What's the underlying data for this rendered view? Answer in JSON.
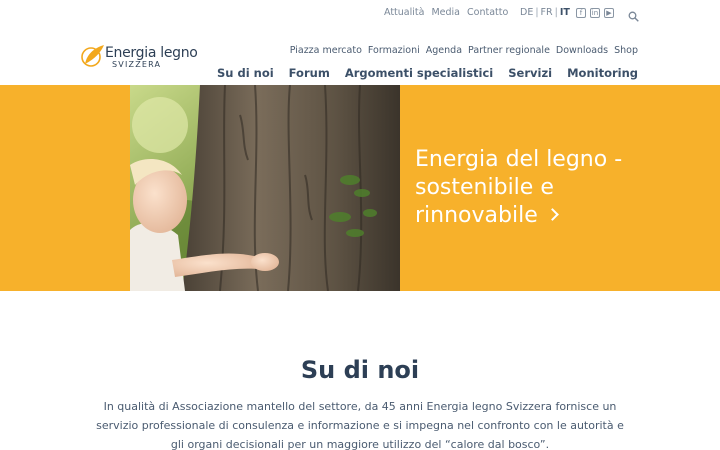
{
  "util": {
    "links": [
      "Attualità",
      "Media",
      "Contatto"
    ],
    "languages": [
      {
        "code": "DE",
        "active": false
      },
      {
        "code": "FR",
        "active": false
      },
      {
        "code": "IT",
        "active": true
      }
    ],
    "social_icons": [
      "facebook-icon",
      "linkedin-icon",
      "youtube-icon"
    ],
    "search_icon": "search-icon"
  },
  "logo": {
    "name": "Energia legno",
    "sub": "SVIZZERA"
  },
  "secondary_nav": [
    "Piazza mercato",
    "Formazioni",
    "Agenda",
    "Partner regionale",
    "Downloads",
    "Shop"
  ],
  "main_nav": [
    "Su di noi",
    "Forum",
    "Argomenti specialistici",
    "Servizi",
    "Monitoring"
  ],
  "hero": {
    "lines": [
      "Energia del legno -",
      "sostenibile e",
      "rinnovabile"
    ],
    "arrow_icon": "chevron-right-icon",
    "background": "#f7b12b"
  },
  "about": {
    "title": "Su di noi",
    "text": "In qualità di Associazione mantello del settore, da 45 anni Energia legno Svizzera fornisce un servizio professionale di consulenza e informazione e si impegna nel confronto con le autorità e gli organi decisionali per un maggiore utilizzo del “calore dal bosco”."
  }
}
